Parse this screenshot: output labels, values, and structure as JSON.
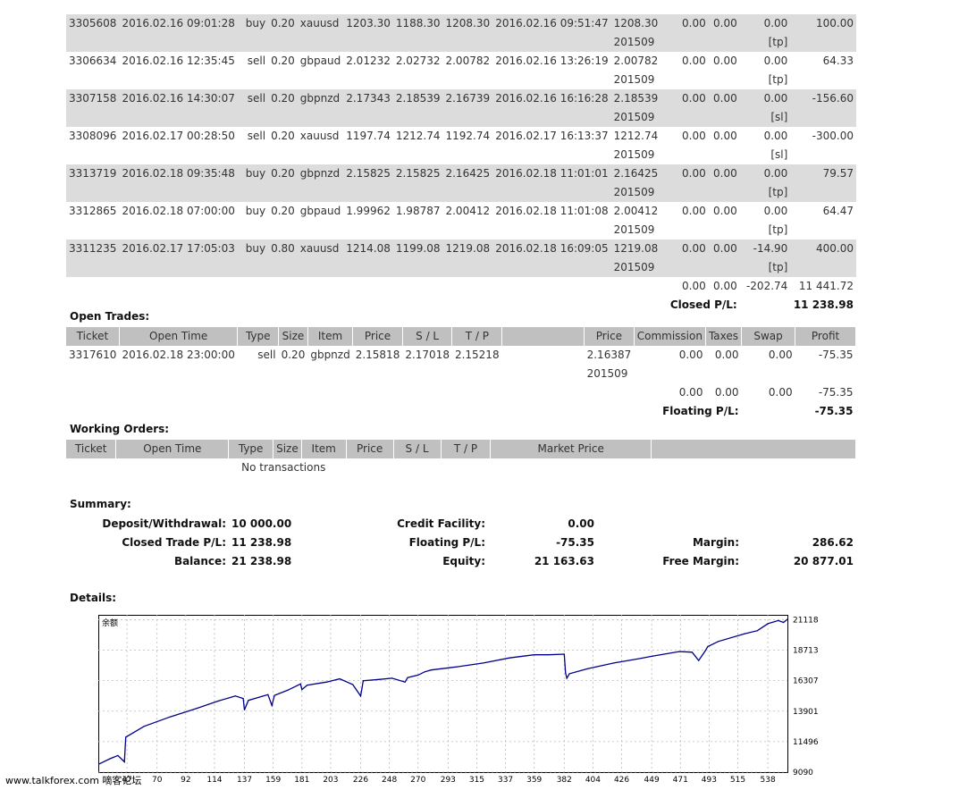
{
  "closed_trades": [
    {
      "ticket": "3305608",
      "open_time": "2016.02.16 09:01:28",
      "type": "buy",
      "size": "0.20",
      "item": "xauusd",
      "price": "1203.30",
      "sl": "1188.30",
      "tp": "1208.30",
      "close_time": "2016.02.16 09:51:47",
      "close_price": "1208.30",
      "commission": "0.00",
      "taxes": "0.00",
      "swap": "0.00",
      "profit": "100.00",
      "sub_price": "201509",
      "sub_flag": "[tp]"
    },
    {
      "ticket": "3306634",
      "open_time": "2016.02.16 12:35:45",
      "type": "sell",
      "size": "0.20",
      "item": "gbpaud",
      "price": "2.01232",
      "sl": "2.02732",
      "tp": "2.00782",
      "close_time": "2016.02.16 13:26:19",
      "close_price": "2.00782",
      "commission": "0.00",
      "taxes": "0.00",
      "swap": "0.00",
      "profit": "64.33",
      "sub_price": "201509",
      "sub_flag": "[tp]"
    },
    {
      "ticket": "3307158",
      "open_time": "2016.02.16 14:30:07",
      "type": "sell",
      "size": "0.20",
      "item": "gbpnzd",
      "price": "2.17343",
      "sl": "2.18539",
      "tp": "2.16739",
      "close_time": "2016.02.16 16:16:28",
      "close_price": "2.18539",
      "commission": "0.00",
      "taxes": "0.00",
      "swap": "0.00",
      "profit": "-156.60",
      "sub_price": "201509",
      "sub_flag": "[sl]"
    },
    {
      "ticket": "3308096",
      "open_time": "2016.02.17 00:28:50",
      "type": "sell",
      "size": "0.20",
      "item": "xauusd",
      "price": "1197.74",
      "sl": "1212.74",
      "tp": "1192.74",
      "close_time": "2016.02.17 16:13:37",
      "close_price": "1212.74",
      "commission": "0.00",
      "taxes": "0.00",
      "swap": "0.00",
      "profit": "-300.00",
      "sub_price": "201509",
      "sub_flag": "[sl]"
    },
    {
      "ticket": "3313719",
      "open_time": "2016.02.18 09:35:48",
      "type": "buy",
      "size": "0.20",
      "item": "gbpnzd",
      "price": "2.15825",
      "sl": "2.15825",
      "tp": "2.16425",
      "close_time": "2016.02.18 11:01:01",
      "close_price": "2.16425",
      "commission": "0.00",
      "taxes": "0.00",
      "swap": "0.00",
      "profit": "79.57",
      "sub_price": "201509",
      "sub_flag": "[tp]"
    },
    {
      "ticket": "3312865",
      "open_time": "2016.02.18 07:00:00",
      "type": "buy",
      "size": "0.20",
      "item": "gbpaud",
      "price": "1.99962",
      "sl": "1.98787",
      "tp": "2.00412",
      "close_time": "2016.02.18 11:01:08",
      "close_price": "2.00412",
      "commission": "0.00",
      "taxes": "0.00",
      "swap": "0.00",
      "profit": "64.47",
      "sub_price": "201509",
      "sub_flag": "[tp]"
    },
    {
      "ticket": "3311235",
      "open_time": "2016.02.17 17:05:03",
      "type": "buy",
      "size": "0.80",
      "item": "xauusd",
      "price": "1214.08",
      "sl": "1199.08",
      "tp": "1219.08",
      "close_time": "2016.02.18 16:09:05",
      "close_price": "1219.08",
      "commission": "0.00",
      "taxes": "0.00",
      "swap": "-14.90",
      "profit": "400.00",
      "sub_price": "201509",
      "sub_flag": "[tp]"
    }
  ],
  "top_partial": {
    "sub_price": "201509",
    "sub_flag": "[tp]"
  },
  "closed_totals": {
    "commission": "0.00",
    "taxes": "0.00",
    "swap": "-202.74",
    "profit": "11 441.72",
    "pl_label": "Closed P/L:",
    "pl_value": "11 238.98"
  },
  "open_trades": {
    "title": "Open Trades:",
    "headers": {
      "ticket": "Ticket",
      "open_time": "Open Time",
      "type": "Type",
      "size": "Size",
      "item": "Item",
      "price": "Price",
      "sl": "S / L",
      "tp": "T / P",
      "price2": "Price",
      "commission": "Commission",
      "taxes": "Taxes",
      "swap": "Swap",
      "profit": "Profit"
    },
    "row": {
      "ticket": "3317610",
      "open_time": "2016.02.18 23:00:00",
      "type": "sell",
      "size": "0.20",
      "item": "gbpnzd",
      "price": "2.15818",
      "sl": "2.17018",
      "tp": "2.15218",
      "market_price": "2.16387",
      "commission": "0.00",
      "taxes": "0.00",
      "swap": "0.00",
      "profit": "-75.35",
      "sub_price": "201509"
    },
    "totals": {
      "commission": "0.00",
      "taxes": "0.00",
      "swap": "0.00",
      "profit": "-75.35"
    },
    "pl_label": "Floating P/L:",
    "pl_value": "-75.35"
  },
  "working_orders": {
    "title": "Working Orders:",
    "headers": {
      "ticket": "Ticket",
      "open_time": "Open Time",
      "type": "Type",
      "size": "Size",
      "item": "Item",
      "price": "Price",
      "sl": "S / L",
      "tp": "T / P",
      "market_price": "Market Price"
    },
    "empty": "No transactions"
  },
  "summary": {
    "title": "Summary:",
    "deposit_label": "Deposit/Withdrawal:",
    "deposit": "10 000.00",
    "credit_label": "Credit Facility:",
    "credit": "0.00",
    "closed_label": "Closed Trade P/L:",
    "closed": "11 238.98",
    "floating_label": "Floating P/L:",
    "floating": "-75.35",
    "margin_label": "Margin:",
    "margin": "286.62",
    "balance_label": "Balance:",
    "balance": "21 238.98",
    "equity_label": "Equity:",
    "equity": "21 163.63",
    "free_margin_label": "Free Margin:",
    "free_margin": "20 877.01"
  },
  "details_title": "Details:",
  "watermark": {
    "site": "www.talkforex.com",
    "cn": "嘀客论坛"
  },
  "chart_data": {
    "type": "line",
    "title": "余额",
    "line_color": "#00008b",
    "x_ticks": [
      47,
      70,
      92,
      114,
      137,
      159,
      181,
      203,
      226,
      248,
      270,
      293,
      315,
      337,
      359,
      382,
      404,
      426,
      449,
      471,
      493,
      515,
      538
    ],
    "y_ticks": [
      9090,
      11496,
      13901,
      16307,
      18713,
      21118
    ],
    "xlim": [
      25,
      553
    ],
    "ylim": [
      9090,
      21500
    ],
    "x": [
      25,
      34,
      40,
      45,
      46,
      60,
      80,
      100,
      117,
      130,
      136,
      137,
      140,
      155,
      158,
      160,
      170,
      180,
      181,
      185,
      200,
      210,
      220,
      226,
      227,
      228,
      240,
      250,
      260,
      262,
      270,
      275,
      280,
      300,
      320,
      340,
      359,
      370,
      382,
      383,
      384,
      386,
      400,
      420,
      440,
      450,
      470,
      480,
      485,
      490,
      492,
      500,
      520,
      530,
      538,
      546,
      550,
      553
    ],
    "y": [
      9700,
      10150,
      10400,
      9900,
      11850,
      12700,
      13450,
      14100,
      14700,
      15100,
      14900,
      14000,
      14750,
      15200,
      14350,
      15150,
      15550,
      16050,
      15600,
      15950,
      16200,
      16450,
      16000,
      15100,
      15700,
      16300,
      16400,
      16500,
      16200,
      16550,
      16750,
      17000,
      17150,
      17400,
      17700,
      18100,
      18350,
      18350,
      18400,
      16900,
      16500,
      16850,
      17250,
      17700,
      18050,
      18250,
      18600,
      18550,
      17900,
      18650,
      19000,
      19400,
      20000,
      20250,
      20800,
      21050,
      20900,
      21150
    ]
  }
}
